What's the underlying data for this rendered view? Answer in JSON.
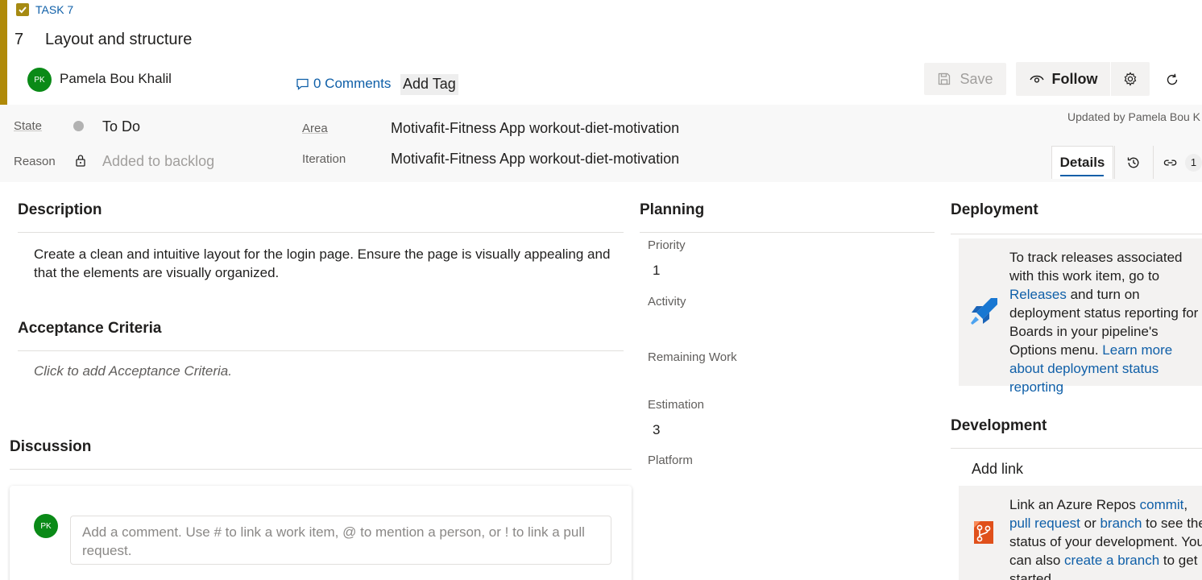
{
  "header": {
    "work_item_type": "TASK 7",
    "id": "7",
    "title": "Layout and structure",
    "assignee_initials": "PK",
    "assignee_name": "Pamela Bou Khalil",
    "comments_label": "0 Comments",
    "add_tag_label": "Add Tag",
    "save_label": "Save",
    "follow_label": "Follow",
    "accent_color": "#b08a08"
  },
  "fields": {
    "state_label": "State",
    "state_value": "To Do",
    "reason_label": "Reason",
    "reason_value": "Added to backlog",
    "area_label": "Area",
    "area_value": "Motivafit-Fitness App workout-diet-motivation",
    "iteration_label": "Iteration",
    "iteration_value": "Motivafit-Fitness App workout-diet-motivation",
    "updated_by": "Updated by Pamela Bou K"
  },
  "tabs": {
    "details_label": "Details",
    "links_count": "1"
  },
  "description": {
    "heading": "Description",
    "text": "Create a clean and intuitive layout for the login page. Ensure the page is visually appealing and that the elements are visually organized."
  },
  "acceptance": {
    "heading": "Acceptance Criteria",
    "placeholder": "Click to add Acceptance Criteria."
  },
  "discussion": {
    "heading": "Discussion",
    "avatar_initials": "PK",
    "input_placeholder": "Add a comment. Use # to link a work item, @ to mention a person, or ! to link a pull request."
  },
  "planning": {
    "heading": "Planning",
    "priority_label": "Priority",
    "priority_value": "1",
    "activity_label": "Activity",
    "remaining_label": "Remaining Work",
    "estimation_label": "Estimation",
    "estimation_value": "3",
    "platform_label": "Platform"
  },
  "deployment": {
    "heading": "Deployment",
    "text_1": "To track releases associated with this work item, go to ",
    "releases_link": "Releases",
    "text_2": " and turn on deployment status reporting for Boards in your pipeline's Options menu. ",
    "learn_more_link": "Learn more about deployment status reporting"
  },
  "development": {
    "heading": "Development",
    "add_link_label": "Add link",
    "text_1": "Link an Azure Repos ",
    "commit_link": "commit",
    "sep_1": ", ",
    "pull_request_link": "pull request",
    "text_2": " or ",
    "branch_link": "branch",
    "text_3": " to see the status of your development. You can also ",
    "create_branch_link": "create a branch",
    "text_4": " to get started."
  }
}
